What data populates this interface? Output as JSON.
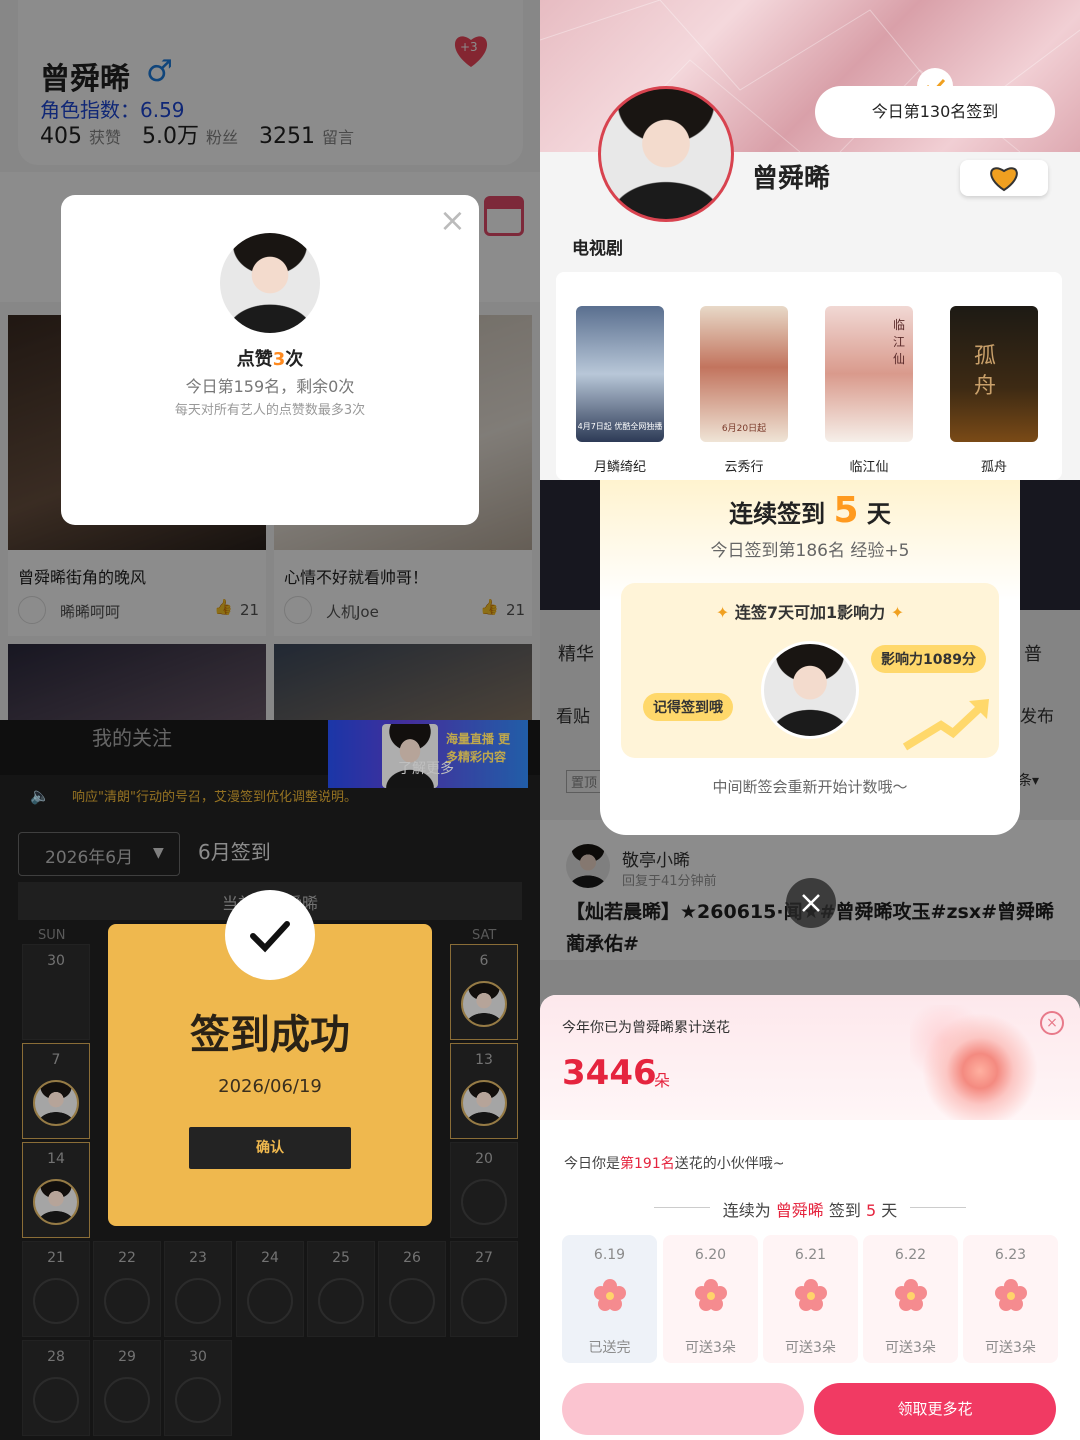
{
  "q1": {
    "name": "曾舜晞",
    "gender_symbol": "♂",
    "index_label": "角色指数：6.59",
    "stats": [
      {
        "value": "405",
        "label": "获赞"
      },
      {
        "value": "5.0万",
        "label": "粉丝"
      },
      {
        "value": "3251",
        "label": "留言"
      }
    ],
    "heart_badge": "+3",
    "like_modal": {
      "title_prefix": "点赞",
      "title_count": "3",
      "title_suffix": "次",
      "rank_text": "今日第159名，剩余0次",
      "note": "每天对所有艺人的点赞数最多3次",
      "close": "×"
    },
    "posts": [
      {
        "title": "曾舜晞街角的晚风",
        "user": "晞晞呵呵",
        "likes": "21"
      },
      {
        "title": "心情不好就看帅哥！",
        "user": "人机Joe",
        "likes": "21"
      }
    ]
  },
  "q2": {
    "sign_rank": "今日第130名签到",
    "name": "曾舜晞",
    "section": "电视剧",
    "dramas": [
      {
        "title": "月鳞绮纪",
        "poster_text": "4月7日起 优酷全网独播"
      },
      {
        "title": "云秀行",
        "poster_text": "6月20日起"
      },
      {
        "title": "临江仙",
        "poster_text": "临江仙"
      },
      {
        "title": "孤舟",
        "poster_text": "孤舟"
      }
    ]
  },
  "q3": {
    "tab": "我的关注",
    "banner_more": "了解更多",
    "banner_promo": "海量直播 更多精彩内容",
    "notice": "响应\"清朗\"行动的号召，艾漫签到优化调整说明。",
    "month_select": "2026年6月",
    "month_title": "6月签到",
    "current_label": "当前：曾舜晞",
    "weekdays": [
      "SUN",
      "SAT"
    ],
    "success_title": "签到成功",
    "success_date": "2026/06/19",
    "confirm": "确认",
    "days": [
      "30",
      "6",
      "7",
      "13",
      "14",
      "20",
      "21",
      "22",
      "23",
      "24",
      "25",
      "26",
      "27",
      "28",
      "29",
      "30"
    ]
  },
  "q4": {
    "streak_title_prefix": "连续签到",
    "streak_days": "5",
    "streak_title_suffix": "天",
    "streak_sub": "今日签到第186名 经验+5",
    "bonus_title": "连签7天可加1影响力",
    "reminder": "记得签到哦",
    "influence": "影响力1089分",
    "footer_note": "中间断签会重新开始计数哦～",
    "bg_tabs": [
      "精华",
      "普",
      "看贴",
      "发布",
      "置顶",
      "条▾"
    ],
    "post_user": "敬亭小晞",
    "post_time": "回复于41分钟前",
    "post_text": "【灿若晨晞】★260615·闻★#曾舜晞攻玉#zsx#曾舜晞蔺承佑#",
    "flower_year_label": "今年你已为曾舜晞累计送花",
    "flower_total": "3446",
    "flower_unit": "朵",
    "flower_rank_prefix": "今日你是",
    "flower_rank": "第191名",
    "flower_rank_suffix": "送花的小伙伴哦~",
    "streak_line_a": "连续为",
    "streak_line_name": "曾舜晞",
    "streak_line_b": "签到",
    "streak_line_days": "5",
    "streak_line_c": "天",
    "flower_days": [
      {
        "date": "6.19",
        "label": "已送完"
      },
      {
        "date": "6.20",
        "label": "可送3朵"
      },
      {
        "date": "6.21",
        "label": "可送3朵"
      },
      {
        "date": "6.22",
        "label": "可送3朵"
      },
      {
        "date": "6.23",
        "label": "可送3朵"
      }
    ],
    "get_more": "领取更多花"
  },
  "colors": {
    "accent_red": "#ff3d6a",
    "orange": "#ff8a1f",
    "gold": "#f0b94d",
    "blue": "#1e48d8"
  }
}
